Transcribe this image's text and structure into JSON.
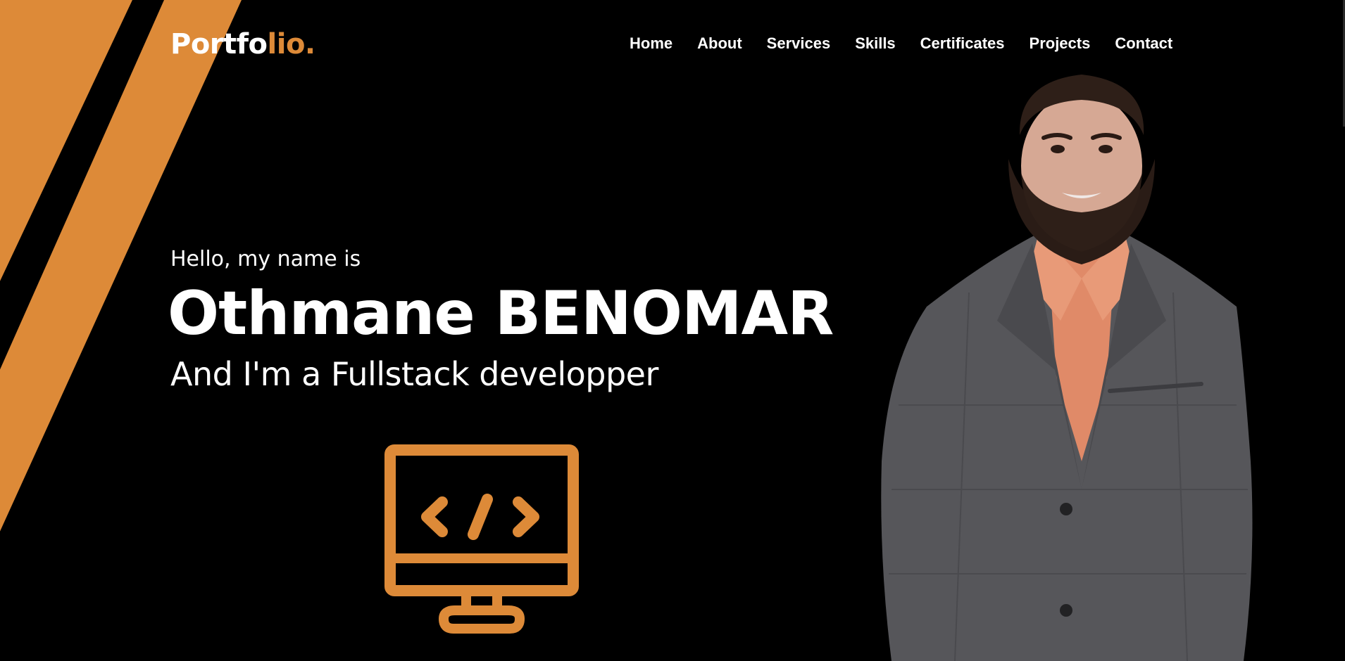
{
  "logo": {
    "text_main": "Portfo",
    "text_accent": "lio."
  },
  "nav": {
    "items": [
      {
        "label": "Home"
      },
      {
        "label": "About"
      },
      {
        "label": "Services"
      },
      {
        "label": "Skills"
      },
      {
        "label": "Certificates"
      },
      {
        "label": "Projects"
      },
      {
        "label": "Contact"
      }
    ]
  },
  "hero": {
    "greeting": "Hello, my name is",
    "name": "Othmane BENOMAR",
    "role": "And I'm a Fullstack developper"
  },
  "colors": {
    "background": "#000000",
    "accent": "#dd8a38",
    "text": "#ffffff"
  },
  "icons": {
    "hero_icon": "code-monitor-icon"
  }
}
